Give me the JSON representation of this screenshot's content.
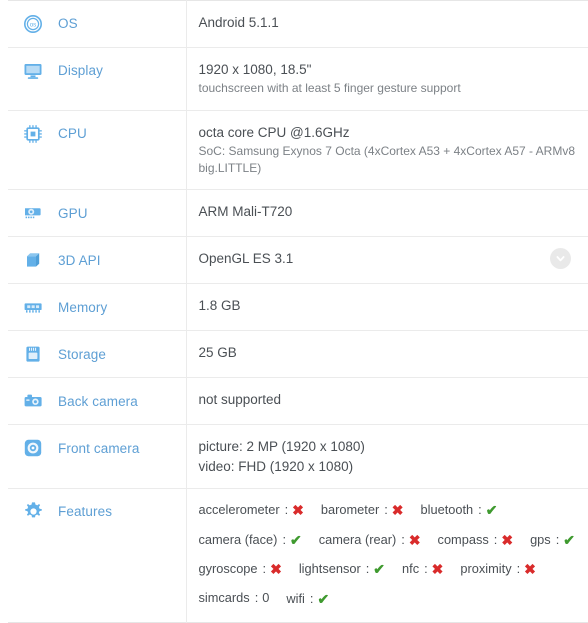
{
  "table": {
    "rows": [
      {
        "id": "os",
        "icon": "os-circle-icon",
        "label": "OS",
        "value": "Android 5.1.1",
        "sub": ""
      },
      {
        "id": "display",
        "icon": "monitor-icon",
        "label": "Display",
        "value": "1920 x 1080, 18.5\"",
        "sub": "touchscreen with at least 5 finger gesture support"
      },
      {
        "id": "cpu",
        "icon": "cpu-chip-icon",
        "label": "CPU",
        "value": "octa core CPU @1.6GHz",
        "sub": "SoC: Samsung Exynos 7 Octa (4xCortex A53 + 4xCortex A57 - ARMv8 big.LITTLE)"
      },
      {
        "id": "gpu",
        "icon": "gpu-card-icon",
        "label": "GPU",
        "value": "ARM Mali-T720",
        "sub": ""
      },
      {
        "id": "3d-api",
        "icon": "cube-3d-icon",
        "label": "3D API",
        "value": "OpenGL ES 3.1",
        "sub": "",
        "expander": "chevron-down-icon"
      },
      {
        "id": "memory",
        "icon": "memory-ram-icon",
        "label": "Memory",
        "value": "1.8 GB",
        "sub": ""
      },
      {
        "id": "storage",
        "icon": "storage-card-icon",
        "label": "Storage",
        "value": "25 GB",
        "sub": ""
      },
      {
        "id": "back-camera",
        "icon": "camera-back-icon",
        "label": "Back camera",
        "value": "not supported",
        "sub": ""
      },
      {
        "id": "front-camera",
        "icon": "camera-front-icon",
        "label": "Front camera",
        "value": "picture: 2 MP (1920 x 1080)",
        "sub": "video: FHD (1920 x 1080)"
      },
      {
        "id": "features",
        "icon": "gear-icon",
        "label": "Features",
        "value": "",
        "sub": ""
      }
    ]
  },
  "features": {
    "rows": [
      [
        {
          "name": "accelerometer",
          "state": "no"
        },
        {
          "name": "barometer",
          "state": "no"
        },
        {
          "name": "bluetooth",
          "state": "yes"
        }
      ],
      [
        {
          "name": "camera (face)",
          "state": "yes"
        },
        {
          "name": "camera (rear)",
          "state": "no"
        },
        {
          "name": "compass",
          "state": "no"
        },
        {
          "name": "gps",
          "state": "yes"
        }
      ],
      [
        {
          "name": "gyroscope",
          "state": "no"
        },
        {
          "name": "lightsensor",
          "state": "yes"
        },
        {
          "name": "nfc",
          "state": "no"
        },
        {
          "name": "proximity",
          "state": "no"
        }
      ],
      [
        {
          "name": "simcards",
          "state": "value",
          "value": "0"
        },
        {
          "name": "wifi",
          "state": "yes"
        }
      ]
    ],
    "separator": ":",
    "yes_glyph": "✔",
    "no_glyph": "✖"
  },
  "colors": {
    "label_blue": "#5e9fd4",
    "icon_blue": "#63b0e8",
    "value_gray": "#4a4f54",
    "sub_gray": "#7c8186",
    "divider": "#ebebeb",
    "yes_green": "#3f9a2f",
    "no_red": "#d92b2b",
    "expander_bg": "#e9e9e9"
  }
}
